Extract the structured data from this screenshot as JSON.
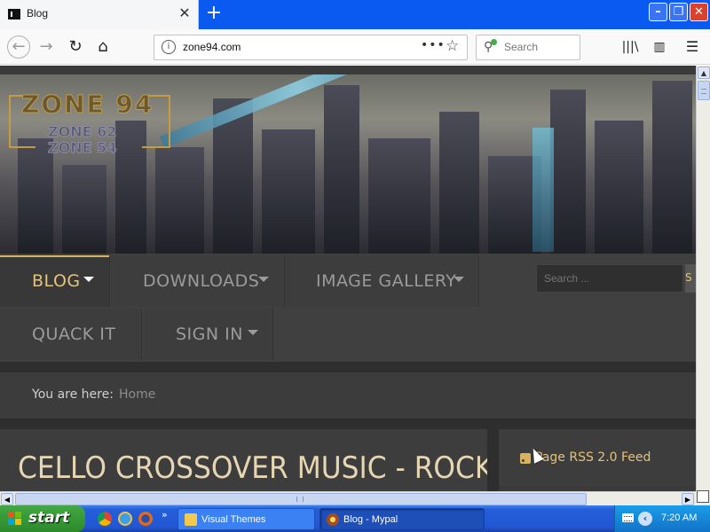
{
  "browser": {
    "tab_title": "Blog",
    "url": "zone94.com",
    "search_placeholder": "Search"
  },
  "site": {
    "logo": {
      "main": "ZONE 94",
      "sub1": "ZONE 62",
      "sub2": "ZONE 54"
    },
    "nav": [
      {
        "label": "BLOG",
        "active": true,
        "dropdown": true
      },
      {
        "label": "DOWNLOADS",
        "active": false,
        "dropdown": true
      },
      {
        "label": "IMAGE GALLERY",
        "active": false,
        "dropdown": true
      },
      {
        "label": "QUACK IT",
        "active": false,
        "dropdown": false
      },
      {
        "label": "SIGN IN",
        "active": false,
        "dropdown": true
      }
    ],
    "search_placeholder": "Search ...",
    "search_button": "S",
    "breadcrumb": {
      "label": "You are here:",
      "home": "Home"
    },
    "article_title": "CELLO CROSSOVER MUSIC - ROCK",
    "rss_label": "Page RSS 2.0 Feed",
    "accent_color": "#e3c37c"
  },
  "taskbar": {
    "start_label": "start",
    "tasks": [
      {
        "label": "Visual Themes",
        "active": false
      },
      {
        "label": "Blog - Mypal",
        "active": true
      }
    ],
    "more": "»",
    "clock": "7:20 AM"
  }
}
